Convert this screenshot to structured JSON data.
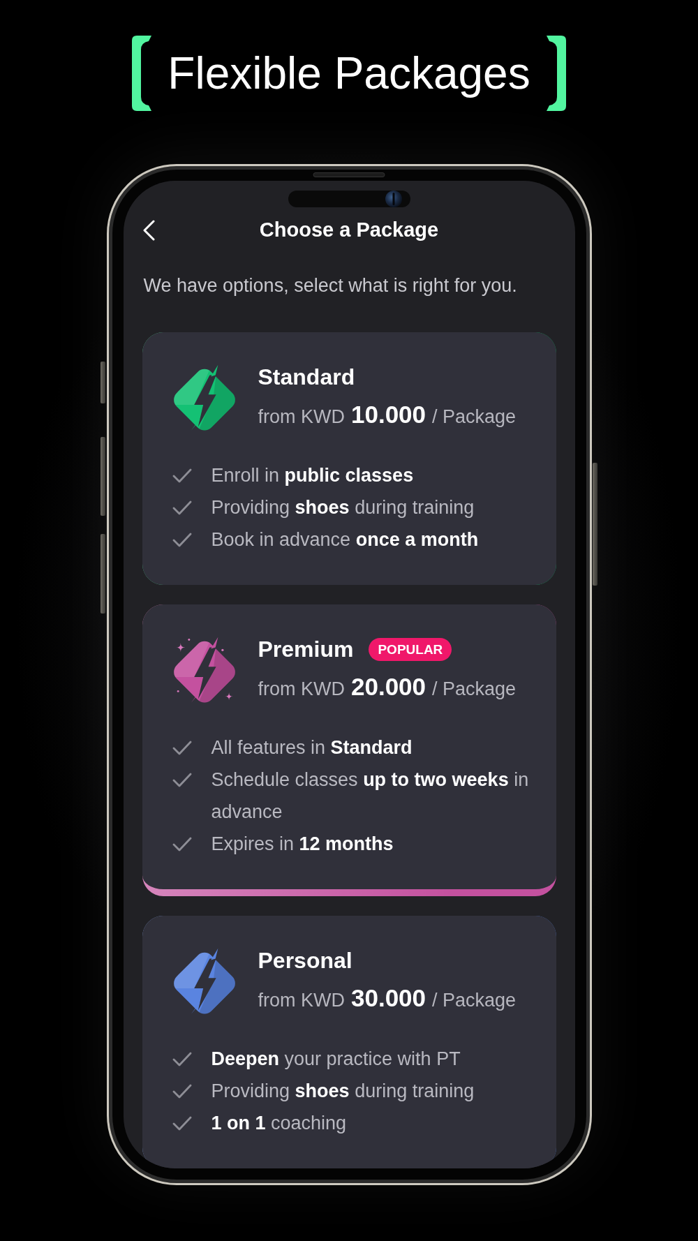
{
  "header": {
    "title": "Flexible Packages"
  },
  "nav": {
    "title": "Choose a Package"
  },
  "intro": "We have options, select what is right for you.",
  "packages": [
    {
      "name": "Standard",
      "color": "#14c174",
      "selected": false,
      "price_prefix": "from KWD",
      "price": "10.000",
      "price_unit": "/ Package",
      "features": [
        "Enroll in **public classes**",
        "Providing **shoes** during training",
        "Book in advance **once a month**"
      ]
    },
    {
      "name": "Premium",
      "badge": "POPULAR",
      "color": "#c4519f",
      "selected": true,
      "price_prefix": "from KWD",
      "price": "20.000",
      "price_unit": "/ Package",
      "features": [
        "All features in **Standard**",
        "Schedule classes **up to two weeks** in advance",
        "Expires in **12 months**"
      ]
    },
    {
      "name": "Personal",
      "color": "#5a84e0",
      "selected": false,
      "price_prefix": "from KWD",
      "price": "30.000",
      "price_unit": "/ Package",
      "features": [
        "**Deepen** your practice with PT",
        "Providing **shoes** during training",
        "**1 on 1** coaching"
      ]
    }
  ]
}
